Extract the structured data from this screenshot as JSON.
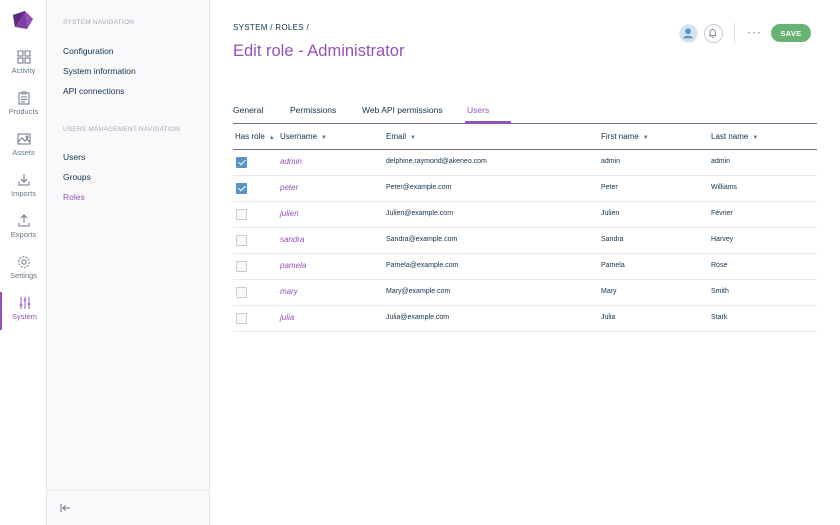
{
  "rail": {
    "items": [
      {
        "label": "Activity",
        "icon": "activity-icon"
      },
      {
        "label": "Products",
        "icon": "products-icon"
      },
      {
        "label": "Assets",
        "icon": "assets-icon"
      },
      {
        "label": "Imports",
        "icon": "imports-icon"
      },
      {
        "label": "Exports",
        "icon": "exports-icon"
      },
      {
        "label": "Settings",
        "icon": "settings-icon"
      },
      {
        "label": "System",
        "icon": "system-icon"
      }
    ],
    "active": "System",
    "accent": "#9452ba"
  },
  "subnav": {
    "system_title": "SYSTEM NAVIGATION",
    "system_items": [
      "Configuration",
      "System information",
      "API connections"
    ],
    "users_title": "USERS MANAGEMENT NAVIGATION",
    "users_items": [
      "Users",
      "Groups",
      "Roles"
    ],
    "active": "Roles"
  },
  "header": {
    "breadcrumb": [
      "SYSTEM",
      "ROLES"
    ],
    "title": "Edit role - Administrator",
    "more_label": "···",
    "save_label": "SAVE",
    "save_color": "#67b373"
  },
  "tabs": {
    "items": [
      "General",
      "Permissions",
      "Web API permissions",
      "Users"
    ],
    "active": "Users"
  },
  "table": {
    "columns": [
      "Has role",
      "Username",
      "Email",
      "First name",
      "Last name"
    ],
    "rows": [
      {
        "has_role": true,
        "username": "admin",
        "email": "delphine.raymond@akeneo.com",
        "first_name": "admin",
        "last_name": "admin"
      },
      {
        "has_role": true,
        "username": "peter",
        "email": "Peter@example.com",
        "first_name": "Peter",
        "last_name": "Williams"
      },
      {
        "has_role": false,
        "username": "julien",
        "email": "Julien@example.com",
        "first_name": "Julien",
        "last_name": "Février"
      },
      {
        "has_role": false,
        "username": "sandra",
        "email": "Sandra@example.com",
        "first_name": "Sandra",
        "last_name": "Harvey"
      },
      {
        "has_role": false,
        "username": "pamela",
        "email": "Pamela@example.com",
        "first_name": "Pamela",
        "last_name": "Rose"
      },
      {
        "has_role": false,
        "username": "mary",
        "email": "Mary@example.com",
        "first_name": "Mary",
        "last_name": "Smith"
      },
      {
        "has_role": false,
        "username": "julia",
        "email": "Julia@example.com",
        "first_name": "Julia",
        "last_name": "Stark"
      }
    ]
  }
}
